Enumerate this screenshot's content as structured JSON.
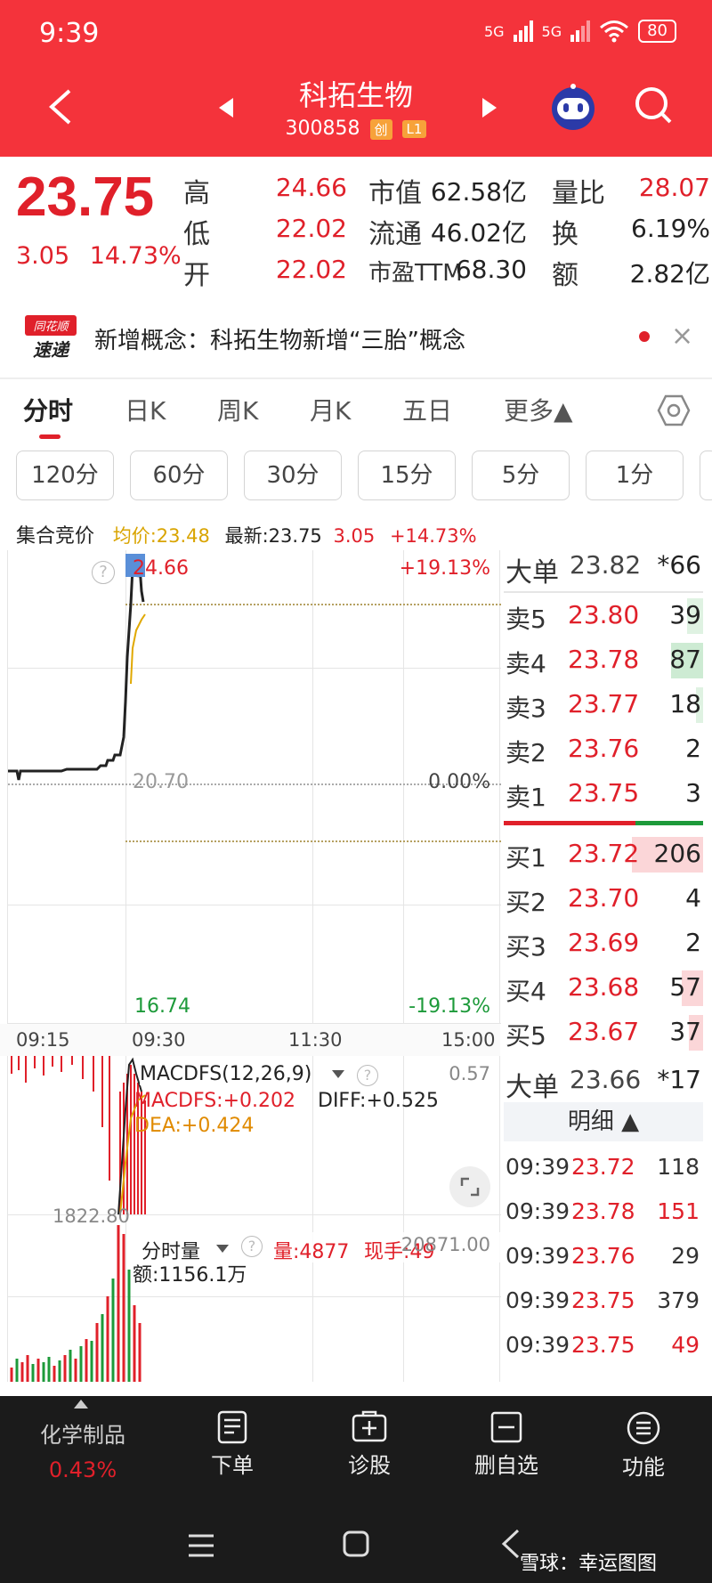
{
  "status": {
    "time": "9:39",
    "net1": "5G",
    "net2": "5G",
    "battery": "80"
  },
  "header": {
    "name": "科拓生物",
    "code": "300858",
    "tag1": "创",
    "tag2": "L1"
  },
  "quote": {
    "price": "23.75",
    "change": "3.05",
    "change_pct": "14.73%",
    "high_label": "高",
    "high": "24.66",
    "low_label": "低",
    "low": "22.02",
    "open_label": "开",
    "open": "22.02",
    "mcap_label": "市值",
    "mcap": "62.58亿",
    "float_label": "流通",
    "float": "46.02亿",
    "pe_label": "市盈TTM",
    "pe": "68.30",
    "vr_label": "量比",
    "vr": "28.07",
    "turn_label": "换",
    "turn": "6.19%",
    "amt_label": "额",
    "amt": "2.82亿"
  },
  "news": {
    "logo_top": "同花顺",
    "logo_bottom": "速递",
    "text": "新增概念：科拓生物新增“三胎”概念"
  },
  "tabs": [
    "分时",
    "日K",
    "周K",
    "月K",
    "五日",
    "更多▲"
  ],
  "periods": [
    "120分",
    "60分",
    "30分",
    "15分",
    "5分",
    "1分"
  ],
  "chart_info": {
    "auction": "集合竞价",
    "avg": "均价:23.48",
    "latest": "最新:23.75",
    "chg": "3.05",
    "pct": "+14.73%"
  },
  "chart": {
    "top_price": "24.66",
    "top_pct": "+19.13%",
    "mid_price": "20.70",
    "mid_pct": "0.00%",
    "bot_price": "16.74",
    "bot_pct": "-19.13%",
    "times": [
      "09:15",
      "09:30",
      "11:30",
      "15:00"
    ],
    "macd_title": "MACDFS(12,26,9)",
    "macd_max": "0.57",
    "macd_val": "MACDFS:+0.202",
    "diff": "DIFF:+0.525",
    "dea": "DEA:+0.424",
    "vol_left": "1822.80",
    "vol_title": "分时量",
    "vol": "量:4877",
    "hand": "现手:49",
    "vol_right": "20871.00",
    "amount": "额:1156.1万"
  },
  "orderbook": {
    "big_top_label": "大单",
    "big_top_price": "23.82",
    "big_top_vol": "*66",
    "sells": [
      {
        "label": "卖5",
        "price": "23.80",
        "vol": "39"
      },
      {
        "label": "卖4",
        "price": "23.78",
        "vol": "87"
      },
      {
        "label": "卖3",
        "price": "23.77",
        "vol": "18"
      },
      {
        "label": "卖2",
        "price": "23.76",
        "vol": "2"
      },
      {
        "label": "卖1",
        "price": "23.75",
        "vol": "3"
      }
    ],
    "buys": [
      {
        "label": "买1",
        "price": "23.72",
        "vol": "206"
      },
      {
        "label": "买2",
        "price": "23.70",
        "vol": "4"
      },
      {
        "label": "买3",
        "price": "23.69",
        "vol": "2"
      },
      {
        "label": "买4",
        "price": "23.68",
        "vol": "57"
      },
      {
        "label": "买5",
        "price": "23.67",
        "vol": "37"
      }
    ],
    "big_bot_label": "大单",
    "big_bot_price": "23.66",
    "big_bot_vol": "*17",
    "detail_label": "明细 ▲",
    "ticks": [
      {
        "time": "09:39",
        "price": "23.72",
        "vol": "118"
      },
      {
        "time": "09:39",
        "price": "23.78",
        "vol": "151"
      },
      {
        "time": "09:39",
        "price": "23.76",
        "vol": "29"
      },
      {
        "time": "09:39",
        "price": "23.75",
        "vol": "379"
      },
      {
        "time": "09:39",
        "price": "23.75",
        "vol": "49"
      }
    ]
  },
  "bottom": {
    "sector": "化学制品",
    "sector_pct": "0.43%",
    "order": "下单",
    "diagnose": "诊股",
    "remove": "删自选",
    "func": "功能"
  },
  "watermark": "雪球：幸运图图",
  "colors": {
    "header": "#f4333b",
    "up": "#e0202a",
    "down": "#1d9a3a"
  }
}
